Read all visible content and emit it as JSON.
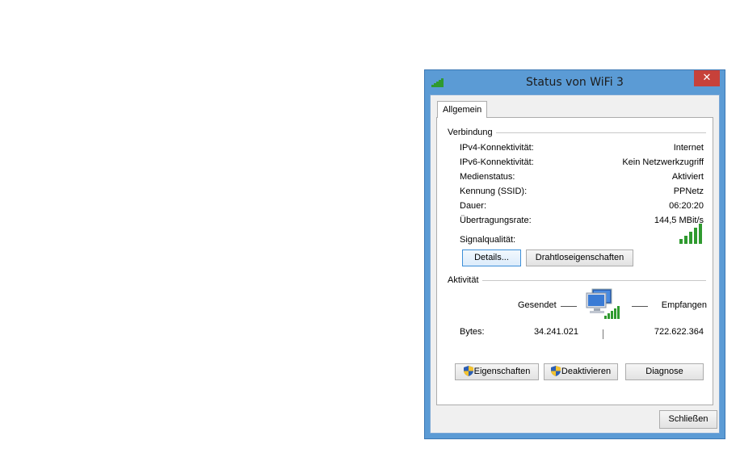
{
  "dialog": {
    "title": "Status von WiFi 3",
    "close_glyph": "✕",
    "tab_label": "Allgemein",
    "connection": {
      "group_label": "Verbindung",
      "rows": [
        {
          "label": "IPv4-Konnektivität:",
          "value": "Internet"
        },
        {
          "label": "IPv6-Konnektivität:",
          "value": "Kein Netzwerkzugriff"
        },
        {
          "label": "Medienstatus:",
          "value": "Aktiviert"
        },
        {
          "label": "Kennung (SSID):",
          "value": "PPNetz"
        },
        {
          "label": "Dauer:",
          "value": "06:20:20"
        },
        {
          "label": "Übertragungsrate:",
          "value": "144,5 MBit/s"
        }
      ],
      "signal_label": "Signalqualität:",
      "signal_bars": 5
    },
    "buttons": {
      "details": "Details...",
      "wireless_props": "Drahtloseigenschaften",
      "properties": "Eigenschaften",
      "deactivate": "Deaktivieren",
      "diagnose": "Diagnose",
      "close": "Schließen"
    },
    "activity": {
      "group_label": "Aktivität",
      "sent_label": "Gesendet",
      "received_label": "Empfangen",
      "bytes_label": "Bytes:",
      "bytes_sent": "34.241.021",
      "bytes_received": "722.622.364"
    },
    "colors": {
      "title_bar": "#5b9bd5",
      "close_button": "#c7413a",
      "signal_green": "#2f9a2f"
    }
  }
}
